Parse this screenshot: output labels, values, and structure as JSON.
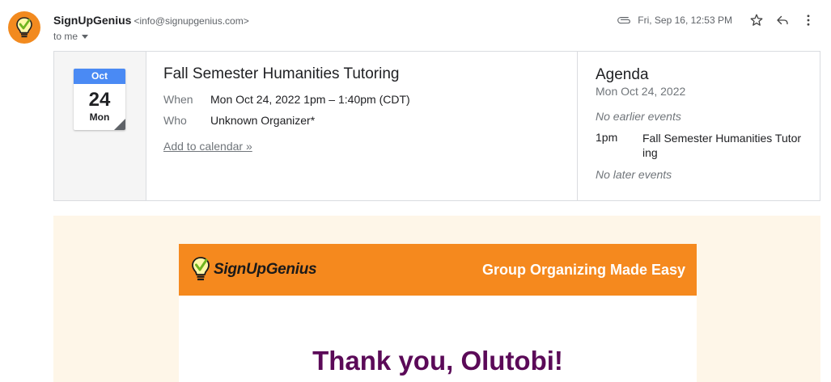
{
  "email": {
    "sender_name": "SignUpGenius",
    "sender_email": "<info@signupgenius.com>",
    "to_label": "to me",
    "timestamp": "Fri, Sep 16, 12:53 PM",
    "icons": [
      "paperclip-icon",
      "star-icon",
      "reply-icon",
      "more-vert-icon"
    ]
  },
  "invite": {
    "calendar_month": "Oct",
    "calendar_day": "24",
    "calendar_weekday": "Mon",
    "title": "Fall Semester Humanities Tutoring",
    "when_label": "When",
    "when_value": "Mon Oct 24, 2022 1pm – 1:40pm (CDT)",
    "who_label": "Who",
    "who_value": "Unknown Organizer*",
    "add_to_calendar": "Add to calendar »"
  },
  "agenda": {
    "title": "Agenda",
    "date": "Mon Oct 24, 2022",
    "no_earlier": "No earlier events",
    "event_time": "1pm",
    "event_title": "Fall Semester Humanities Tutoring",
    "no_later": "No later events"
  },
  "message": {
    "logo_text": "SignUpGenius",
    "tagline": "Group Organizing Made Easy",
    "greeting": "Thank you, Olutobi!"
  },
  "colors": {
    "brand_orange": "#f5891e",
    "calendar_blue": "#4a8af4",
    "greeting_purple": "#5b0a58",
    "body_bg": "#fef6e8"
  }
}
